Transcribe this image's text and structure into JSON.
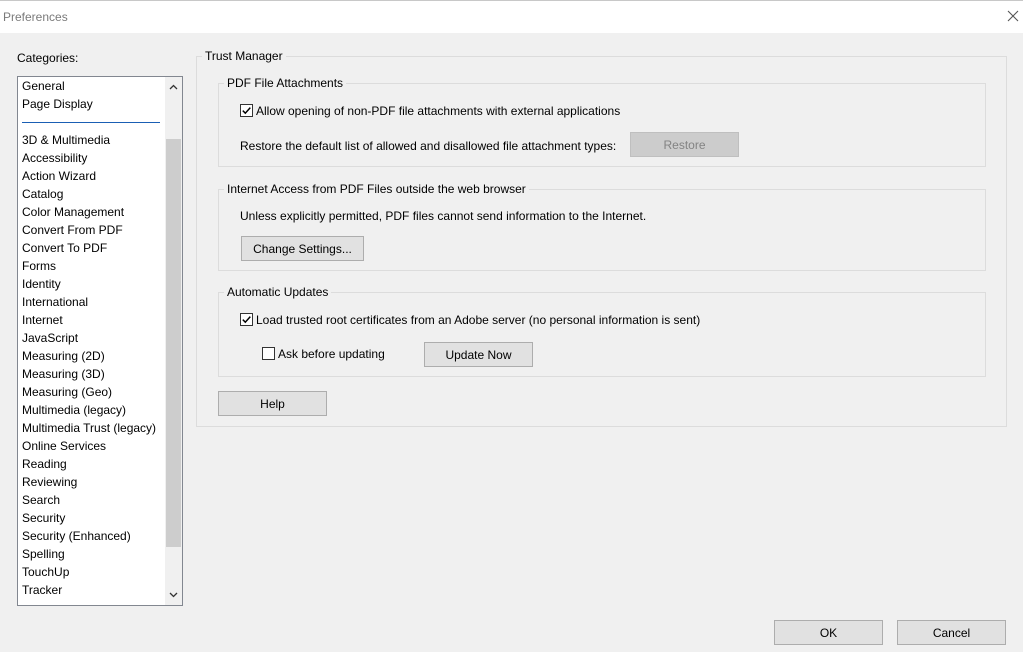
{
  "window": {
    "title": "Preferences"
  },
  "sidebar": {
    "label": "Categories:",
    "items": [
      "General",
      "Page Display",
      "3D & Multimedia",
      "Accessibility",
      "Action Wizard",
      "Catalog",
      "Color Management",
      "Convert From PDF",
      "Convert To PDF",
      "Forms",
      "Identity",
      "International",
      "Internet",
      "JavaScript",
      "Measuring (2D)",
      "Measuring (3D)",
      "Measuring (Geo)",
      "Multimedia (legacy)",
      "Multimedia Trust (legacy)",
      "Online Services",
      "Reading",
      "Reviewing",
      "Search",
      "Security",
      "Security (Enhanced)",
      "Spelling",
      "TouchUp",
      "Tracker"
    ]
  },
  "trust_manager": {
    "title": "Trust Manager",
    "attachments": {
      "title": "PDF File Attachments",
      "allow_label": "Allow opening of non-PDF file attachments with external applications",
      "allow_checked": true,
      "restore_text": "Restore the default list of allowed and disallowed file attachment types:",
      "restore_button": "Restore"
    },
    "internet": {
      "title": "Internet Access from PDF Files outside the web browser",
      "description": "Unless explicitly permitted, PDF files cannot send information to the Internet.",
      "change_button": "Change Settings..."
    },
    "updates": {
      "title": "Automatic Updates",
      "load_label": "Load trusted root certificates from an Adobe server (no personal information is sent)",
      "load_checked": true,
      "ask_label": "Ask before updating",
      "ask_checked": false,
      "update_button": "Update Now"
    },
    "help_button": "Help"
  },
  "footer": {
    "ok_button": "OK",
    "cancel_button": "Cancel"
  }
}
